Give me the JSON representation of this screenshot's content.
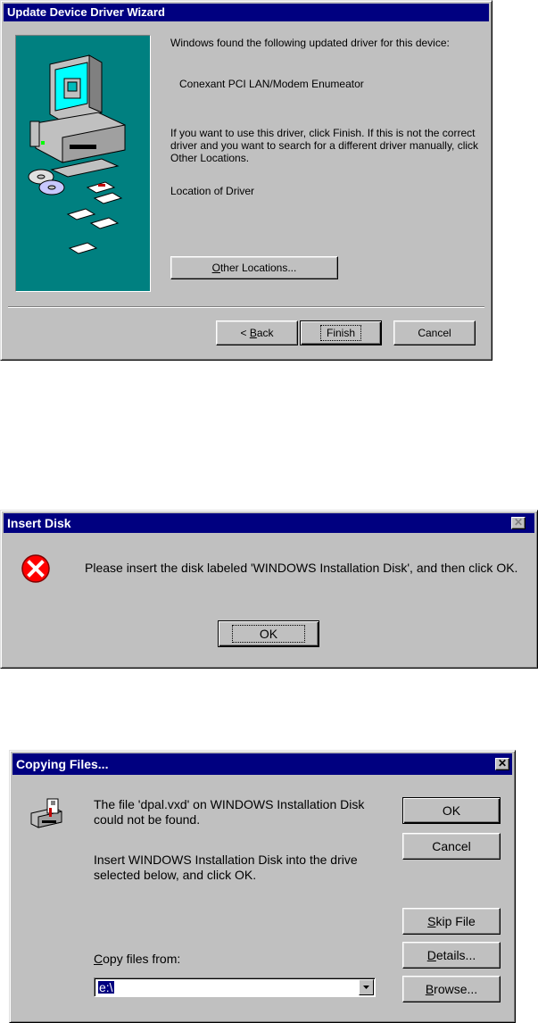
{
  "wizard": {
    "title": "Update Device Driver Wizard",
    "line1": "Windows found the following updated driver for this device:",
    "device_name": "Conexant PCI LAN/Modem Enumeator",
    "instructions": "If you want to use this driver, click Finish. If this is not the correct driver and you want to search for a different driver manually, click Other Locations.",
    "location_label": "Location of Driver",
    "other_locations_pre": "",
    "other_locations_ul": "O",
    "other_locations_post": "ther Locations...",
    "back_pre": "< ",
    "back_ul": "B",
    "back_post": "ack",
    "finish_label": "Finish",
    "cancel_label": "Cancel",
    "panel_color": "#008080"
  },
  "insert_disk": {
    "title": "Insert Disk",
    "close_glyph": "✕",
    "message": "Please insert the disk labeled 'WINDOWS Installation Disk', and then click OK.",
    "ok_label": "OK",
    "icon": "error-icon",
    "icon_color": "#ff0000"
  },
  "copying": {
    "title": "Copying Files...",
    "close_glyph": "✕",
    "message1": "The file 'dpal.vxd' on WINDOWS Installation Disk could not be found.",
    "message2": "Insert WINDOWS Installation Disk into the drive selected below, and click OK.",
    "copy_from_pre": "",
    "copy_from_ul": "C",
    "copy_from_post": "opy files from:",
    "path_value": "e:\\",
    "ok_label": "OK",
    "cancel_label": "Cancel",
    "skip_pre": "",
    "skip_ul": "S",
    "skip_post": "kip File",
    "details_pre": "",
    "details_ul": "D",
    "details_post": "etails...",
    "browse_pre": "",
    "browse_ul": "B",
    "browse_post": "rowse...",
    "icon": "drive-icon"
  }
}
